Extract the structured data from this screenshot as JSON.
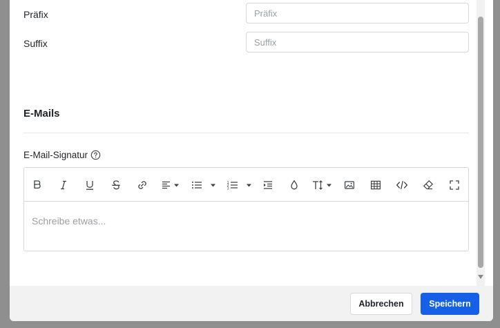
{
  "form": {
    "prefix": {
      "label": "Präfix",
      "value": "",
      "placeholder": "Präfix"
    },
    "suffix": {
      "label": "Suffix",
      "value": "",
      "placeholder": "Suffix"
    }
  },
  "emails_section": {
    "title": "E-Mails"
  },
  "signature": {
    "label": "E-Mail-Signatur",
    "placeholder": "Schreibe etwas...",
    "toolbar_icons": [
      "bold-icon",
      "italic-icon",
      "underline-icon",
      "strikethrough-icon",
      "link-icon",
      "align-icon",
      "bullet-list-icon",
      "numbered-list-icon",
      "indent-icon",
      "color-drop-icon",
      "text-size-icon",
      "image-icon",
      "table-icon",
      "code-icon",
      "eraser-icon",
      "fullscreen-icon"
    ]
  },
  "footer": {
    "cancel_label": "Abbrechen",
    "save_label": "Speichern"
  },
  "colors": {
    "primary": "#1560e6",
    "border": "#d6d8db",
    "footer_bg": "#f2f2f2"
  }
}
